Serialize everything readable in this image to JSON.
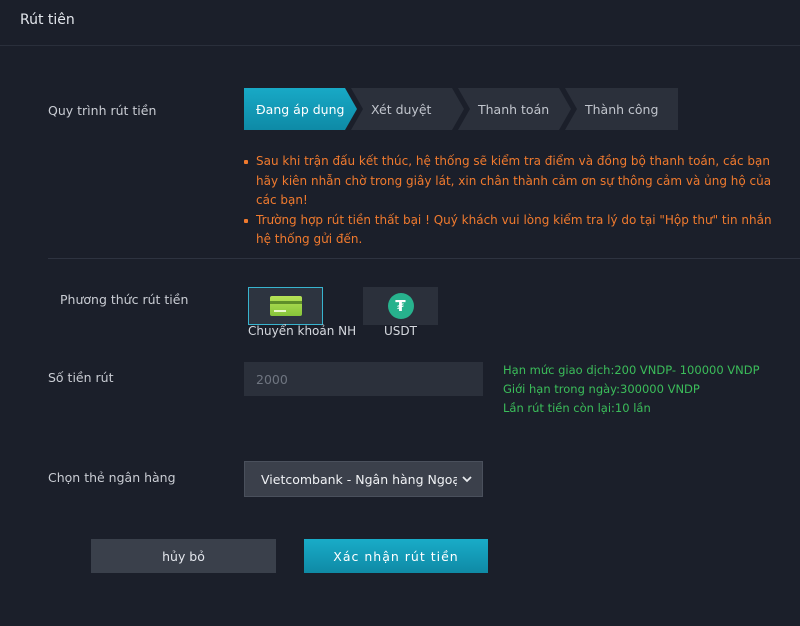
{
  "page": {
    "title": "Rút tiên"
  },
  "process": {
    "label": "Quy trình rút tiền",
    "steps": [
      "Đang áp dụng",
      "Xét duyệt",
      "Thanh toán",
      "Thành công"
    ]
  },
  "notes": [
    "Sau khi trận đấu kết thúc, hệ thống sẽ kiểm tra điểm và đồng bộ thanh toán, các bạn hãy kiên nhẫn chờ trong giây lát, xin chân thành cảm ơn sự thông cảm và ủng hộ của các bạn!",
    "Trường hợp rút tiền thất bại ! Quý khách vui lòng kiểm tra lý do tại \"Hộp thư\" tin nhắn hệ thống gửi đến."
  ],
  "method": {
    "label": "Phương thức rút tiền",
    "options": [
      {
        "name": "Chuyển khoản NH",
        "icon": "bank-card-icon",
        "selected": true
      },
      {
        "name": "USDT",
        "icon": "tether-icon",
        "symbol": "₮",
        "selected": false
      }
    ]
  },
  "amount": {
    "label": "Số tiền rút",
    "placeholder": "2000",
    "limits": [
      "Hạn mức giao dịch:200 VNDP- 100000 VNDP",
      "Giới hạn trong ngày:300000 VNDP",
      "Lần rút tiền còn lại:10 lần"
    ]
  },
  "bank": {
    "label": "Chọn thẻ ngân hàng",
    "selected": "Vietcombank - Ngân hàng Ngoại thương"
  },
  "actions": {
    "cancel_label": "hủy bỏ",
    "confirm_label": "Xác nhận rút tiền"
  },
  "colors": {
    "accent": "#13a0bd",
    "warning": "#f07a2e",
    "success": "#3bbd5a",
    "background": "#1b1f2a"
  }
}
